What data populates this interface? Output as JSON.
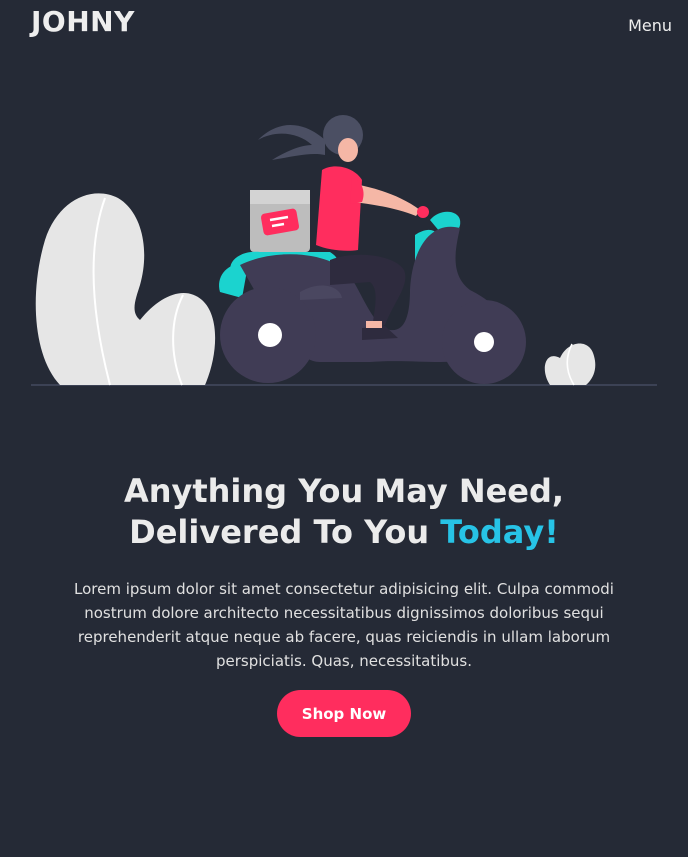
{
  "header": {
    "logo": "JOHNY",
    "menu_label": "Menu"
  },
  "hero": {
    "illustration_name": "delivery-scooter-illustration",
    "headline_line1": "Anything You May Need,",
    "headline_line2_prefix": "Delivered To You ",
    "headline_accent": "Today!",
    "description": "Lorem ipsum dolor sit amet consectetur adipisicing elit. Culpa commodi nostrum dolore architecto necessitatibus dignissimos doloribus sequi reprehenderit atque neque ab facere, quas reiciendis in ullam laborum perspiciatis. Quas, necessitatibus.",
    "cta_label": "Shop Now"
  },
  "colors": {
    "background": "#252a36",
    "accent": "#27c3e6",
    "cta": "#ff2d5e",
    "text": "#ebebeb"
  }
}
